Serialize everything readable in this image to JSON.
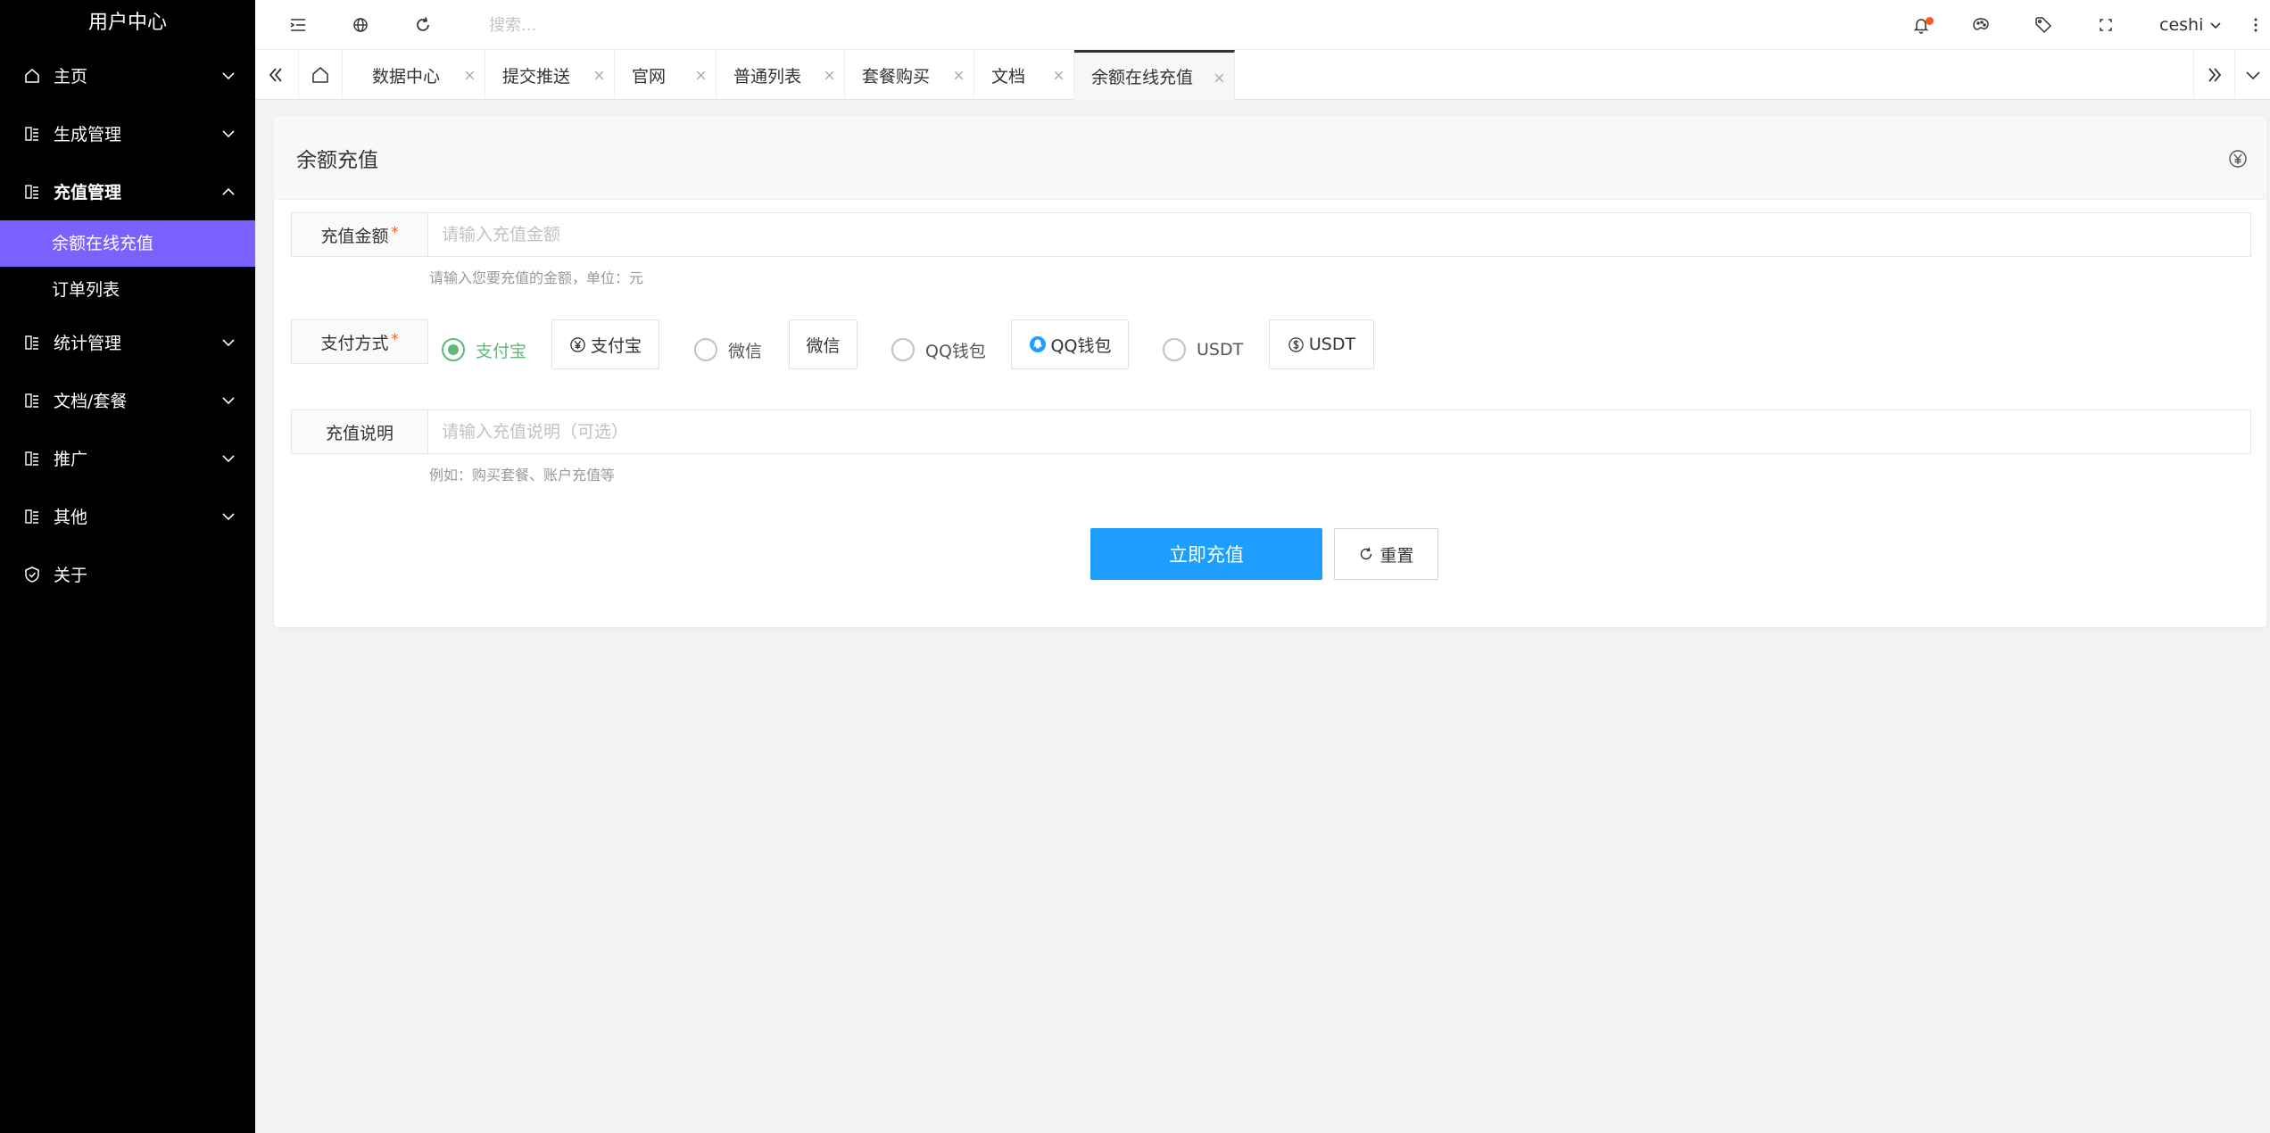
{
  "sidebar": {
    "title": "用户中心",
    "items": [
      {
        "label": "主页",
        "icon": "home-icon",
        "expanded": false
      },
      {
        "label": "生成管理",
        "icon": "grid-icon",
        "expanded": false
      },
      {
        "label": "充值管理",
        "icon": "grid-icon",
        "expanded": true
      },
      {
        "label": "统计管理",
        "icon": "grid-icon",
        "expanded": false
      },
      {
        "label": "文档/套餐",
        "icon": "grid-icon",
        "expanded": false
      },
      {
        "label": "推广",
        "icon": "grid-icon",
        "expanded": false
      },
      {
        "label": "其他",
        "icon": "grid-icon",
        "expanded": false
      },
      {
        "label": "关于",
        "icon": "shield-check-icon",
        "expanded": false
      }
    ],
    "submenu": [
      {
        "label": "余额在线充值",
        "active": true
      },
      {
        "label": "订单列表",
        "active": false
      }
    ],
    "active_color": "#7b61ff"
  },
  "topbar": {
    "search_placeholder": "搜索...",
    "user_name": "ceshi",
    "icons": [
      "menu-fold-icon",
      "globe-icon",
      "refresh-icon",
      "bell-icon",
      "palette-icon",
      "tag-icon",
      "fullscreen-icon",
      "more-vertical-icon"
    ]
  },
  "tabs": [
    {
      "label": "数据中心",
      "active": false
    },
    {
      "label": "提交推送",
      "active": false
    },
    {
      "label": "官网",
      "active": false
    },
    {
      "label": "普通列表",
      "active": false
    },
    {
      "label": "套餐购买",
      "active": false
    },
    {
      "label": "文档",
      "active": false
    },
    {
      "label": "余额在线充值",
      "active": true
    }
  ],
  "card": {
    "title": "余额充值",
    "amount": {
      "label": "充值金额",
      "required_mark": "*",
      "placeholder": "请输入充值金额",
      "value": "",
      "help": "请输入您要充值的金额，单位：元"
    },
    "payment": {
      "label": "支付方式",
      "required_mark": "*",
      "selected": "支付宝",
      "options": [
        {
          "radio_label": "支付宝",
          "box_label": "支付宝",
          "icon": "yen-circle-icon"
        },
        {
          "radio_label": "微信",
          "box_label": "微信",
          "icon": ""
        },
        {
          "radio_label": "QQ钱包",
          "box_label": "QQ钱包",
          "icon": "qq-icon"
        },
        {
          "radio_label": "USDT",
          "box_label": "USDT",
          "icon": "dollar-circle-icon"
        }
      ]
    },
    "description": {
      "label": "充值说明",
      "placeholder": "请输入充值说明（可选）",
      "value": "",
      "help": "例如：购买套餐、账户充值等"
    },
    "submit_label": "立即充值",
    "reset_label": "重置"
  },
  "colors": {
    "primary": "#1e9fff",
    "success": "#5fb878",
    "notify_dot": "#ff5722"
  }
}
